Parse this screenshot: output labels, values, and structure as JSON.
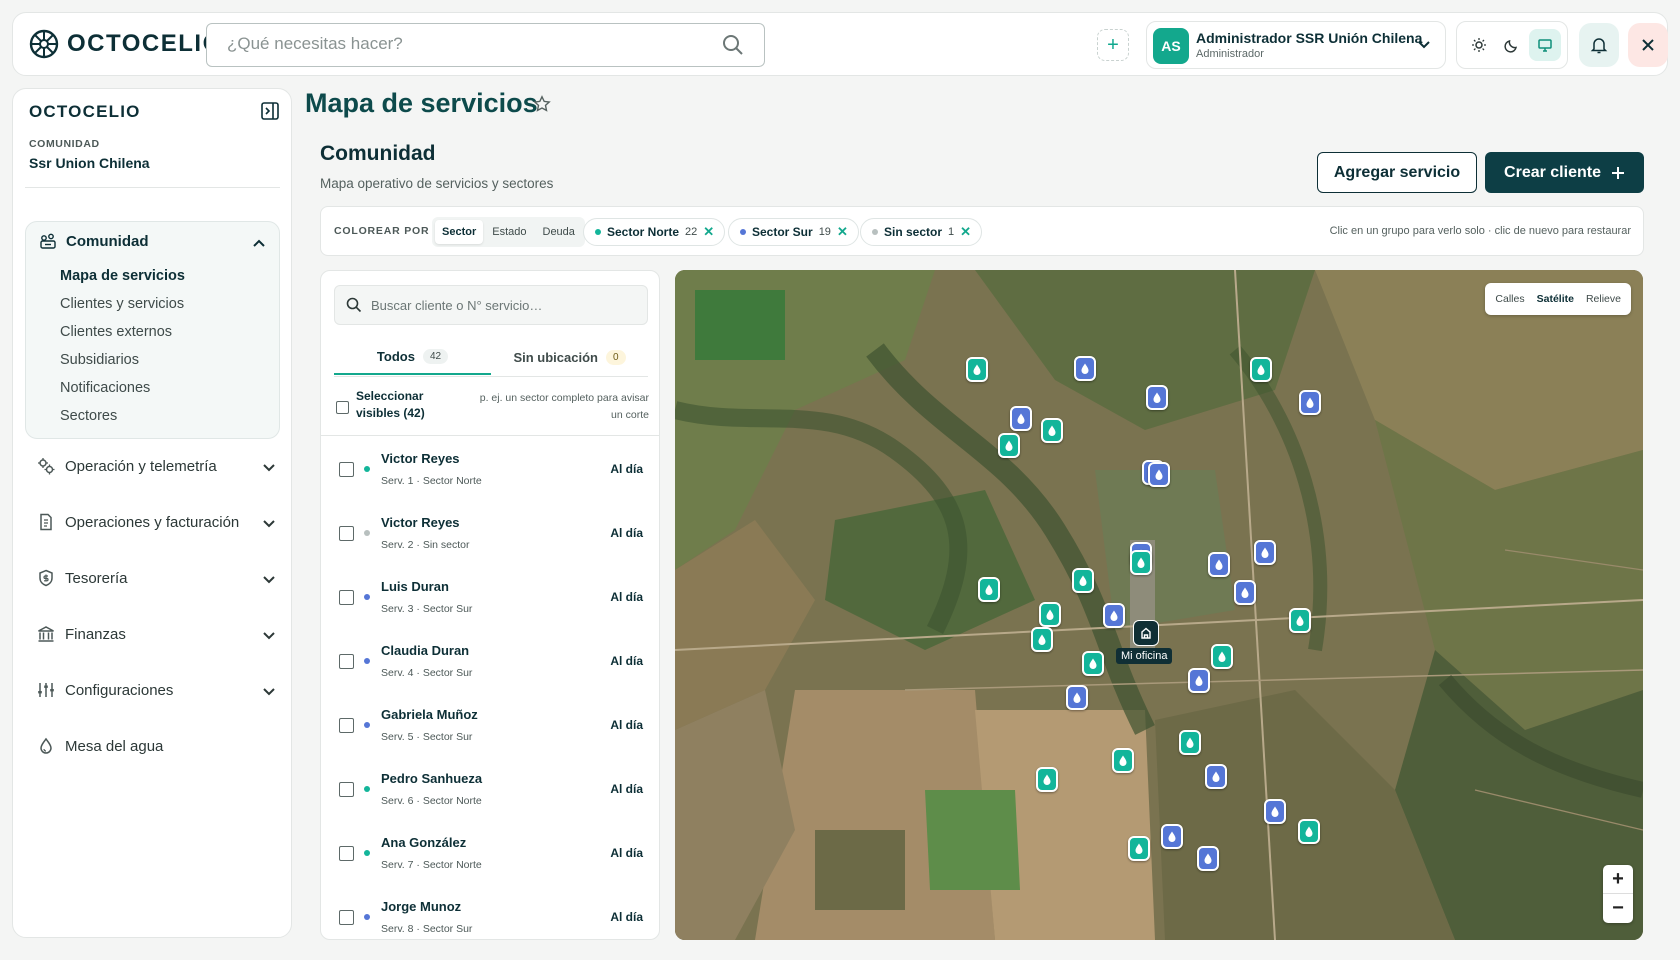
{
  "app": {
    "brand": "OCTOCELIO",
    "search_placeholder": "¿Qué necesitas hacer?",
    "user": {
      "initials": "AS",
      "name": "Administrador SSR Unión Chilena",
      "role": "Administrador"
    }
  },
  "sidebar": {
    "brand": "OCTOCELIO",
    "org_label": "COMUNIDAD",
    "org_name": "Ssr Union Chilena",
    "group": {
      "title": "Comunidad",
      "items": [
        "Mapa de servicios",
        "Clientes y servicios",
        "Clientes externos",
        "Subsidiarios",
        "Notificaciones",
        "Sectores"
      ]
    },
    "nav": [
      {
        "label": "Operación y telemetría",
        "icon": "gears-icon"
      },
      {
        "label": "Operaciones y facturación",
        "icon": "invoice-icon"
      },
      {
        "label": "Tesorería",
        "icon": "shield-dollar-icon"
      },
      {
        "label": "Finanzas",
        "icon": "bank-icon"
      },
      {
        "label": "Configuraciones",
        "icon": "sliders-icon"
      },
      {
        "label": "Mesa del agua",
        "icon": "water-drop-icon"
      }
    ]
  },
  "page": {
    "title": "Mapa de servicios",
    "section_title": "Comunidad",
    "section_subtitle": "Mapa operativo de servicios y sectores",
    "add_service": "Agregar servicio",
    "create_client": "Crear cliente"
  },
  "filters": {
    "color_by_label": "COLOREAR POR",
    "modes": [
      "Sector",
      "Estado",
      "Deuda"
    ],
    "active_mode": "Sector",
    "chips": [
      {
        "label": "Sector Norte",
        "count": "22",
        "color": "#13b59a"
      },
      {
        "label": "Sector Sur",
        "count": "19",
        "color": "#5576d6"
      },
      {
        "label": "Sin sector",
        "count": "1",
        "color": "#b8c0bf"
      }
    ],
    "hint": "Clic en un grupo para verlo solo · clic de nuevo para restaurar"
  },
  "list": {
    "search_placeholder": "Buscar cliente o N° servicio…",
    "tabs": [
      {
        "label": "Todos",
        "count": "42"
      },
      {
        "label": "Sin ubicación",
        "count": "0"
      }
    ],
    "select_all": "Seleccionar visibles (42)",
    "select_hint": "p. ej. un sector completo para avisar un corte",
    "rows": [
      {
        "name": "Victor Reyes",
        "sub": "Serv. 1 · Sector Norte",
        "status": "Al día",
        "sector": "norte"
      },
      {
        "name": "Victor Reyes",
        "sub": "Serv. 2 · Sin sector",
        "status": "Al día",
        "sector": "none"
      },
      {
        "name": "Luis Duran",
        "sub": "Serv. 3 · Sector Sur",
        "status": "Al día",
        "sector": "sur"
      },
      {
        "name": "Claudia Duran",
        "sub": "Serv. 4 · Sector Sur",
        "status": "Al día",
        "sector": "sur"
      },
      {
        "name": "Gabriela Muñoz",
        "sub": "Serv. 5 · Sector Sur",
        "status": "Al día",
        "sector": "sur"
      },
      {
        "name": "Pedro Sanhueza",
        "sub": "Serv. 6 · Sector Norte",
        "status": "Al día",
        "sector": "norte"
      },
      {
        "name": "Ana González",
        "sub": "Serv. 7 · Sector Norte",
        "status": "Al día",
        "sector": "norte"
      },
      {
        "name": "Jorge Munoz",
        "sub": "Serv. 8 · Sector Sur",
        "status": "Al día",
        "sector": "sur"
      }
    ]
  },
  "map": {
    "types": [
      "Calles",
      "Satélite",
      "Relieve"
    ],
    "active_type": "Satélite",
    "office_label": "Mi oficina",
    "zoom_in": "+",
    "zoom_out": "−"
  }
}
